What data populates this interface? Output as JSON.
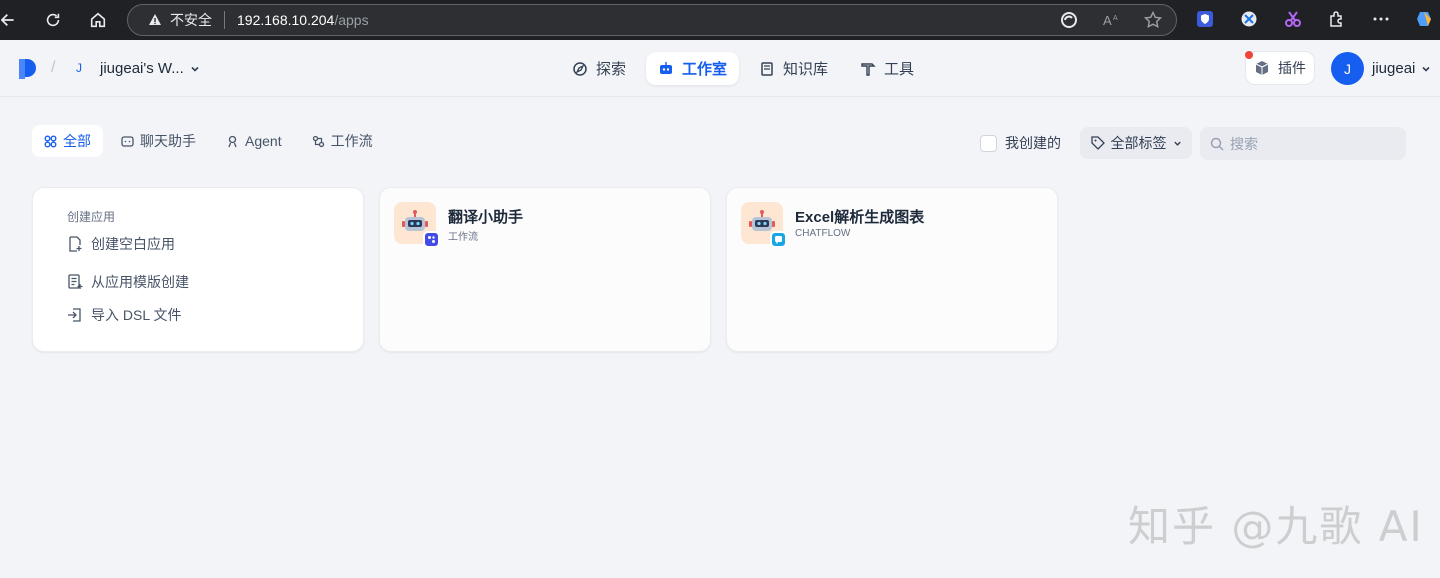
{
  "browser": {
    "security_label": "不安全",
    "url_host": "192.168.10.204",
    "url_path": "/apps"
  },
  "header": {
    "workspace_avatar": "J",
    "workspace_name": "jiugeai's W...",
    "nav": [
      {
        "label": "探索",
        "icon": "compass-icon"
      },
      {
        "label": "工作室",
        "icon": "robot-icon"
      },
      {
        "label": "知识库",
        "icon": "book-icon"
      },
      {
        "label": "工具",
        "icon": "hammer-icon"
      }
    ],
    "plugin_label": "插件",
    "user_initial": "J",
    "user_name": "jiugeai"
  },
  "filters": {
    "tabs": [
      {
        "label": "全部",
        "icon": "grid-icon"
      },
      {
        "label": "聊天助手",
        "icon": "chat-icon"
      },
      {
        "label": "Agent",
        "icon": "agent-icon"
      },
      {
        "label": "工作流",
        "icon": "workflow-icon"
      }
    ],
    "mine_label": "我创建的",
    "tags_label": "全部标签",
    "search_placeholder": "搜索"
  },
  "create": {
    "title": "创建应用",
    "items": [
      {
        "label": "创建空白应用",
        "icon": "file-plus-icon"
      },
      {
        "label": "从应用模版创建",
        "icon": "template-icon"
      },
      {
        "label": "导入 DSL 文件",
        "icon": "import-icon"
      }
    ]
  },
  "apps": [
    {
      "name": "翻译小助手",
      "type": "工作流",
      "badge_color": "#444ce7"
    },
    {
      "name": "Excel解析生成图表",
      "type": "CHATFLOW",
      "badge_color": "#1aa6e5"
    }
  ],
  "watermark": "知乎 @九歌 AI",
  "colors": {
    "accent": "#155eef",
    "page_bg": "#f2f4f7",
    "browser_bar": "#202124"
  }
}
